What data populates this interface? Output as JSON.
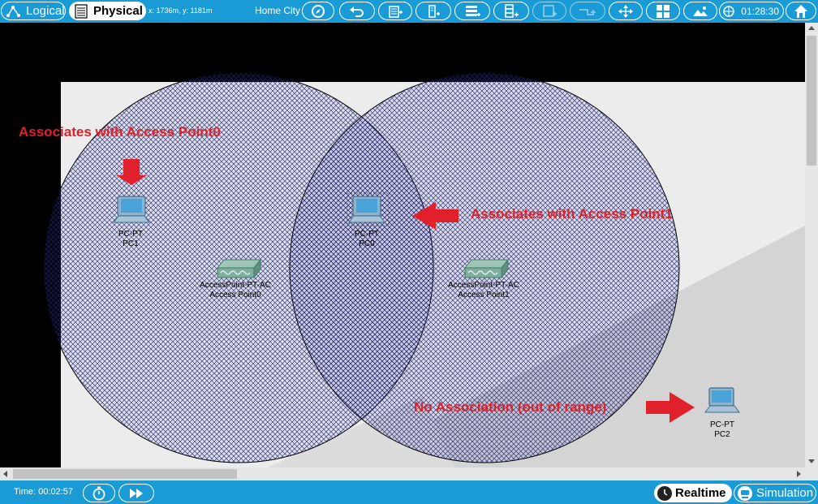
{
  "toolbar": {
    "logical_label": "Logical",
    "physical_label": "Physical",
    "coordinates": "x: 1736m, y: 1181m",
    "location": "Home City",
    "clock": "01:28:30",
    "icons": [
      "navigation-icon",
      "undo-icon",
      "new-building-icon",
      "new-closet-icon",
      "new-rack-icon",
      "new-cabinet-icon",
      "new-container-icon",
      "new-cable-icon",
      "move-icon",
      "grid-icon",
      "background-icon",
      "clock-globe-icon",
      "home-icon"
    ]
  },
  "canvas": {
    "annotations": {
      "ap0": "Associates with Access Point0",
      "ap1": "Associates with Access Point1",
      "none": "No Association (out of range)"
    },
    "devices": [
      {
        "type": "PC-PT",
        "name": "PC1"
      },
      {
        "type": "PC-PT",
        "name": "PC0"
      },
      {
        "type": "AccessPoint-PT-AC",
        "name": "Access Point0"
      },
      {
        "type": "AccessPoint-PT-AC",
        "name": "Access Point1"
      },
      {
        "type": "PC-PT",
        "name": "PC2"
      }
    ]
  },
  "statusbar": {
    "time": "Time: 00:02:57",
    "realtime_label": "Realtime",
    "simulation_label": "Simulation"
  },
  "colors": {
    "bar": "#1a9bd6",
    "annotation": "#e0202a"
  }
}
